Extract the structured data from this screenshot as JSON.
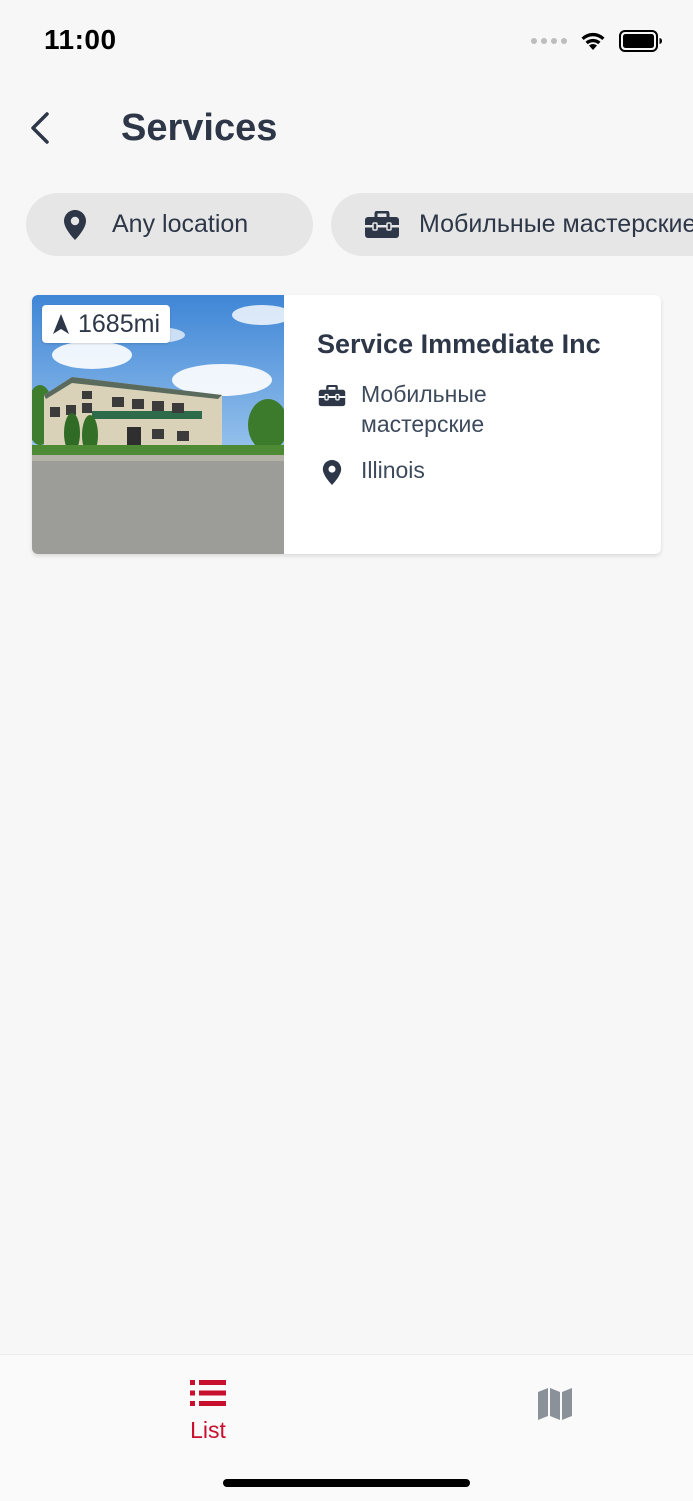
{
  "status_bar": {
    "time": "11:00"
  },
  "header": {
    "title": "Services"
  },
  "filters": {
    "location_label": "Any location",
    "category_label": "Мобильные мастерские"
  },
  "results": [
    {
      "distance": "1685mi",
      "title": "Service Immediate Inc",
      "category": "Мобильные мастерские",
      "location": "Illinois"
    }
  ],
  "tabs": {
    "list_label": "List",
    "active": "list"
  },
  "colors": {
    "accent": "#c8102e",
    "text": "#2d3748",
    "chip_bg": "#e6e6e6",
    "background": "#f7f7f7"
  },
  "icons": [
    "back-icon",
    "location-pin-icon",
    "briefcase-icon",
    "navigation-arrow-icon",
    "list-icon",
    "map-icon"
  ]
}
